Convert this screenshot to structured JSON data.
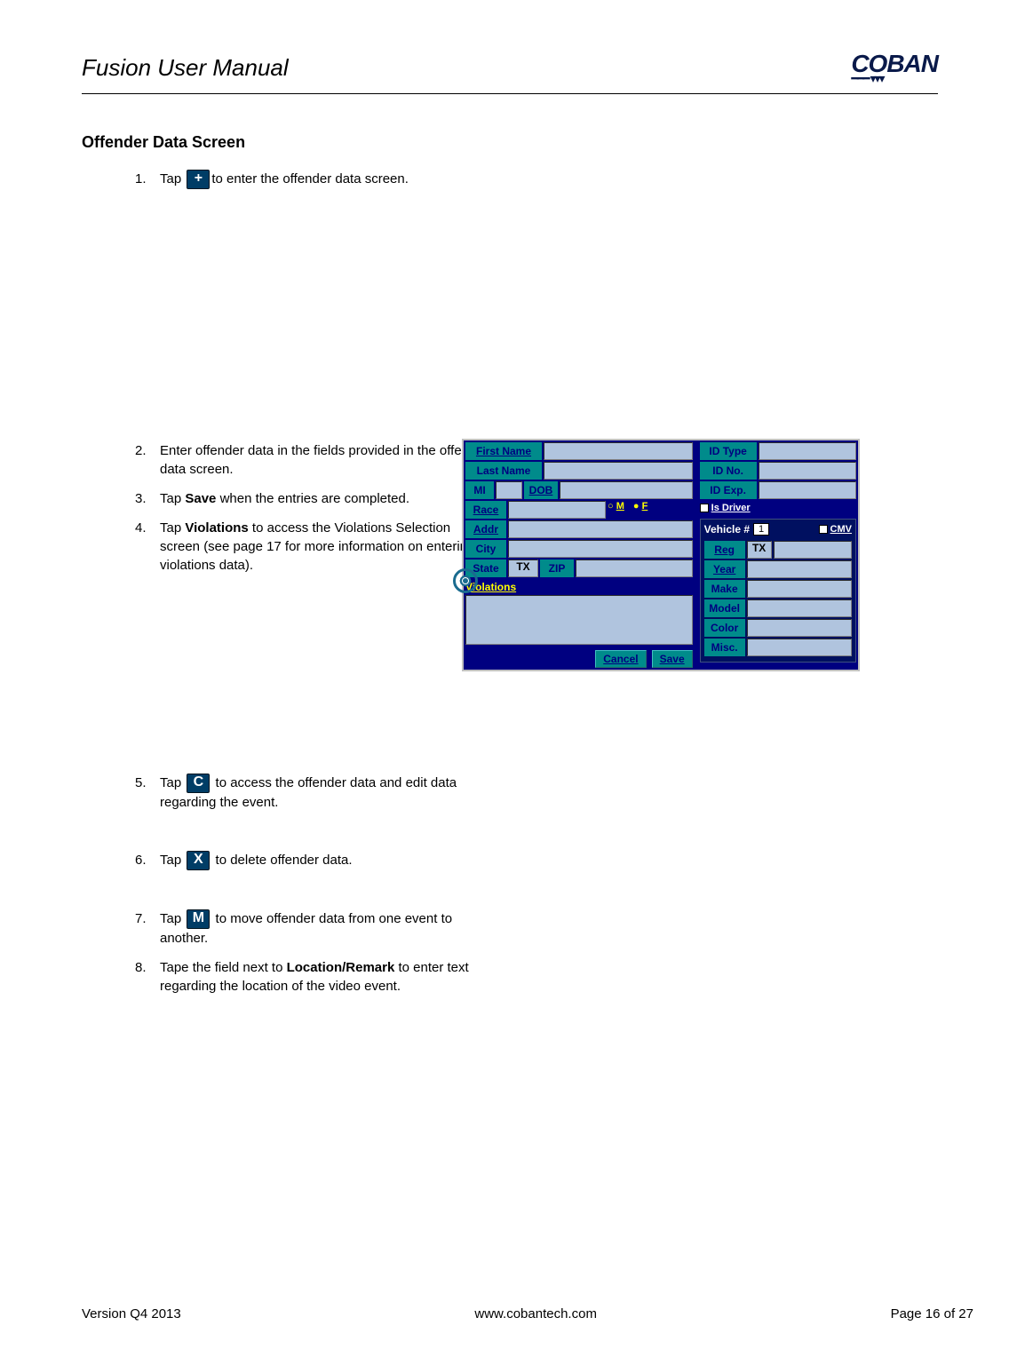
{
  "header": {
    "title": "Fusion User Manual",
    "brand": "COBAN"
  },
  "section": {
    "title": "Offender Data Screen"
  },
  "steps": {
    "s1_num": "1.",
    "s1_a": "Tap ",
    "s1_b": "to enter the offender data screen.",
    "s2_num": "2.",
    "s2": "Enter offender data in the fields provided in the offender data screen.",
    "s3_num": "3.",
    "s3_a": "Tap ",
    "s3_bold": "Save",
    "s3_b": " when the entries are completed.",
    "s4_num": "4.",
    "s4_a": "Tap ",
    "s4_bold": "Violations",
    "s4_b": " to access the Violations Selection screen (see page 17 for more information on entering violations data).",
    "s5_num": "5.",
    "s5_a": "Tap ",
    "s5_b": " to access the offender data and edit data regarding the event.",
    "s6_num": "6.",
    "s6_a": "Tap ",
    "s6_b": " to delete offender data.",
    "s7_num": "7.",
    "s7_a": "Tap ",
    "s7_b": " to move offender data from one event to another.",
    "s8_num": "8.",
    "s8_a": "Tape the field next to ",
    "s8_bold": "Location/Remark",
    "s8_b": " to enter text regarding the location of the video event."
  },
  "icons": {
    "plus": "+",
    "c": "C",
    "x": "X",
    "m": "M"
  },
  "form": {
    "first_name": "First Name",
    "last_name": "Last Name",
    "mi": "MI",
    "dob": "DOB",
    "race": "Race",
    "addr": "Addr",
    "city": "City",
    "state": "State",
    "tx": "TX",
    "zip": "ZIP",
    "radio_m": "M",
    "radio_f": "F",
    "violations": "Violations",
    "cancel": "Cancel",
    "save": "Save",
    "id_type": "ID Type",
    "id_no": "ID No.",
    "id_exp": "ID Exp.",
    "is_driver": "Is Driver",
    "vehicle_num": "Vehicle #",
    "veh_value": "1",
    "cmv": "CMV",
    "reg": "Reg",
    "year": "Year",
    "make": "Make",
    "model": "Model",
    "color": "Color",
    "misc": "Misc."
  },
  "footer": {
    "version": "Version Q4 2013",
    "url": "www.cobantech.com",
    "page": "Page 16 of 27"
  }
}
